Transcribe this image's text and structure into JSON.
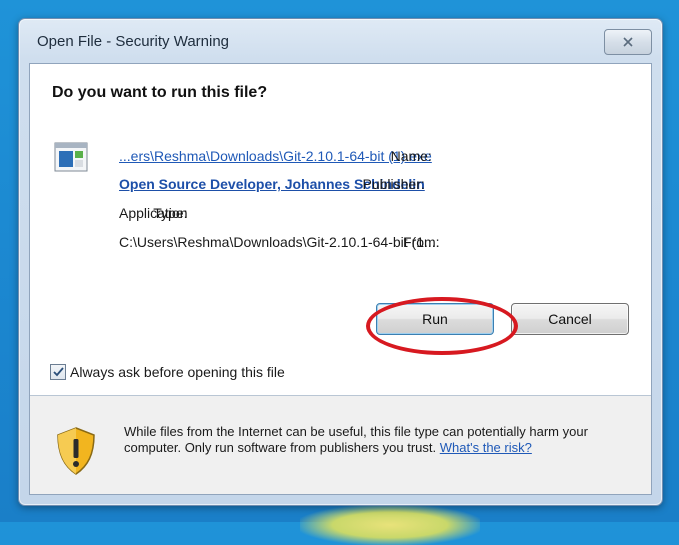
{
  "window": {
    "title": "Open File - Security Warning"
  },
  "dialog": {
    "heading": "Do you want to run this file?",
    "fields": {
      "name_label": "Name:",
      "name_value": "...ers\\Reshma\\Downloads\\Git-2.10.1-64-bit (1).exe",
      "publisher_label": "Publisher:",
      "publisher_value": "Open Source Developer, Johannes Schindelin",
      "type_label": "Type:",
      "type_value": "Application",
      "from_label": "From:",
      "from_value": "C:\\Users\\Reshma\\Downloads\\Git-2.10.1-64-bit (1...."
    },
    "buttons": {
      "run": "Run",
      "cancel": "Cancel"
    },
    "checkbox": {
      "label": "Always ask before opening this file",
      "checked": true
    },
    "warning": {
      "text": "While files from the Internet can be useful, this file type can potentially harm your computer. Only run software from publishers you trust.",
      "link": "What's the risk?"
    }
  },
  "colors": {
    "desktop": "#1f93d8",
    "link": "#1f59b7",
    "highlight_circle": "#d71920"
  }
}
